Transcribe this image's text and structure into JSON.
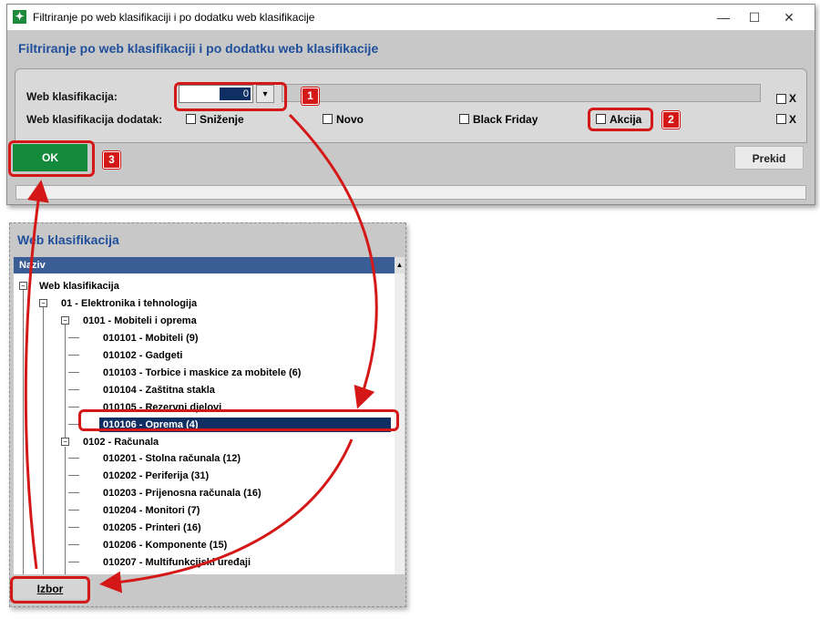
{
  "dialog": {
    "title": "Filtriranje po web klasifikaciji i po dodatku web klasifikacije",
    "heading": "Filtriranje po web klasifikaciji i po dodatku web klasifikacije",
    "web_klasifikacija_label": "Web klasifikacija:",
    "web_klasifikacija_value": "0",
    "dodatak_label": "Web klasifikacija dodatak:",
    "checkboxes": [
      {
        "label": "Sniženje",
        "checked": false
      },
      {
        "label": "Novo",
        "checked": false
      },
      {
        "label": "Black Friday",
        "checked": false
      },
      {
        "label": "Akcija",
        "checked": false
      }
    ],
    "x_label_1": "X",
    "x_label_2": "X",
    "ok_label": "OK",
    "cancel_label": "Prekid"
  },
  "tree": {
    "heading": "Web klasifikacija",
    "column_header": "Naziv",
    "root": "Web klasifikacija",
    "level1": "01 - Elektronika i tehnologija",
    "group1": "0101 - Mobiteli i oprema",
    "group1_items": [
      "010101 - Mobiteli (9)",
      "010102 - Gadgeti",
      "010103 - Torbice i maskice za mobitele (6)",
      "010104 - Zaštitna stakla",
      "010105 - Rezervni djelovi",
      "010106 - Oprema (4)"
    ],
    "group2": "0102 - Računala",
    "group2_items": [
      "010201 - Stolna računala (12)",
      "010202 - Periferija (31)",
      "010203 - Prijenosna računala (16)",
      "010204 - Monitori (7)",
      "010205 - Printeri (16)",
      "010206 - Komponente (15)",
      "010207 - Multifunkcijski uređaji"
    ],
    "selected_item": "010106 - Oprema (4)",
    "izbor_label": "Izbor"
  },
  "annotations": {
    "badge1": "1",
    "badge2": "2",
    "badge3": "3",
    "color": "#d41818"
  }
}
